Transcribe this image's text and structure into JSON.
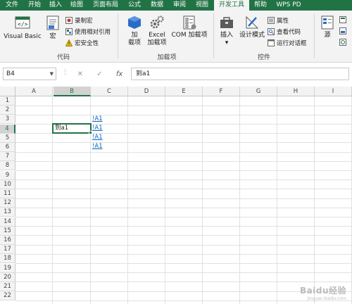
{
  "tabs": [
    "文件",
    "开始",
    "插入",
    "绘图",
    "页面布局",
    "公式",
    "数据",
    "审阅",
    "视图",
    "开发工具",
    "帮助",
    "WPS PD"
  ],
  "active_tab": "开发工具",
  "ribbon": {
    "code_group": {
      "label": "代码",
      "visual_basic": "Visual Basic",
      "macros": "宏",
      "record_macro": "录制宏",
      "relative_ref": "使用相对引用",
      "macro_security": "宏安全性"
    },
    "addins_group": {
      "label": "加载项",
      "addins_l1": "加",
      "addins_l2": "载项",
      "excel_addins_l1": "Excel",
      "excel_addins_l2": "加载项",
      "com_addins": "COM 加载项"
    },
    "controls_group": {
      "label": "控件",
      "insert": "插入",
      "design_mode": "设计模式",
      "properties": "属性",
      "view_code": "查看代码",
      "run_dialog": "运行对话框"
    },
    "xml_group": {
      "source": "源"
    }
  },
  "formula_bar": {
    "name_box": "B4",
    "cancel": "✕",
    "enter": "✓",
    "fx": "fx",
    "content": "到a1"
  },
  "columns": [
    "A",
    "B",
    "C",
    "D",
    "E",
    "F",
    "G",
    "H",
    "I"
  ],
  "selected_column": "B",
  "rows": [
    "1",
    "2",
    "3",
    "4",
    "5",
    "6",
    "7",
    "8",
    "9",
    "10",
    "11",
    "12",
    "13",
    "14",
    "15",
    "16",
    "17",
    "18",
    "19",
    "20",
    "21",
    "22"
  ],
  "selected_row": "4",
  "cells": {
    "B4": "到a1",
    "C3": "!A1",
    "C4": "!A1",
    "C5": "!A1",
    "C6": "!A1"
  },
  "watermark": {
    "main": "Baidu经验",
    "sub": "jingyan.baidu.com"
  },
  "colors": {
    "excel_green": "#217346",
    "link_blue": "#0563c1"
  }
}
